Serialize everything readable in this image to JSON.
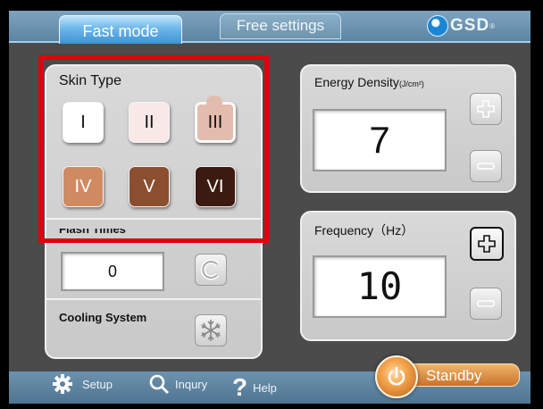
{
  "tabs": {
    "fast_mode": "Fast mode",
    "free_settings": "Free settings"
  },
  "logo": {
    "text": "GSD",
    "mark": "®"
  },
  "skin_type": {
    "label": "Skin Type",
    "options": [
      {
        "label": "I",
        "color": "#ffffff",
        "text_color": "#111111"
      },
      {
        "label": "II",
        "color": "#f8e8e8",
        "text_color": "#111111"
      },
      {
        "label": "III",
        "color": "#e4bcae",
        "text_color": "#111111"
      },
      {
        "label": "IV",
        "color": "#d08a62",
        "text_color": "#ffffff"
      },
      {
        "label": "V",
        "color": "#8b4e2e",
        "text_color": "#ffffff"
      },
      {
        "label": "VI",
        "color": "#3b1b10",
        "text_color": "#ffffff"
      }
    ],
    "selected": "III"
  },
  "flash_times": {
    "label": "Flash Times",
    "value": "0"
  },
  "cooling_system": {
    "label": "Cooling System"
  },
  "energy_density": {
    "label": "Energy Density",
    "unit": "(J/cm²)",
    "value": "7"
  },
  "frequency": {
    "label": "Frequency（Hz）",
    "value": "10"
  },
  "bottom_bar": {
    "setup": "Setup",
    "inquiry": "Inqury",
    "help": "Help"
  },
  "standby": {
    "label": "Standby"
  },
  "colors": {
    "accent": "#3f93d4",
    "highlight": "#e3000b",
    "standby": "#e08a3c"
  }
}
